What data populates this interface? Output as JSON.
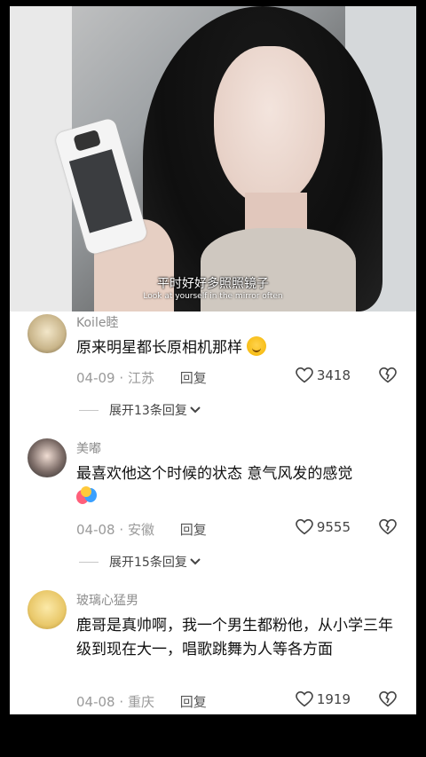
{
  "video": {
    "subtitle_cn": "平时好好多照照镜子",
    "subtitle_en": "Look at yourself in the mirror often"
  },
  "comments": [
    {
      "username": "Koile睦",
      "text": "原来明星都长原相机那样",
      "emoji_icon": "crying-face-emoji-icon",
      "date": "04-09",
      "location": "江苏",
      "reply_label": "回复",
      "likes": "3418",
      "expand_label": "展开13条回复"
    },
    {
      "username": "美嘟",
      "text": "最喜欢他这个时候的状态 意气风发的感觉",
      "emoji_icon": "hug-emoji-icon",
      "date": "04-08",
      "location": "安徽",
      "reply_label": "回复",
      "likes": "9555",
      "expand_label": "展开15条回复"
    },
    {
      "username": "玻璃心猛男",
      "text": "鹿哥是真帅啊，我一个男生都粉他，从小学三年级到现在大一，唱歌跳舞为人等各方面",
      "date": "04-08",
      "location": "重庆",
      "reply_label": "回复",
      "likes": "1919"
    }
  ],
  "separator": "·",
  "colors": {
    "background": "#000000",
    "panel": "#ffffff",
    "username": "#8d8d8d",
    "meta": "#9a9a9a"
  }
}
